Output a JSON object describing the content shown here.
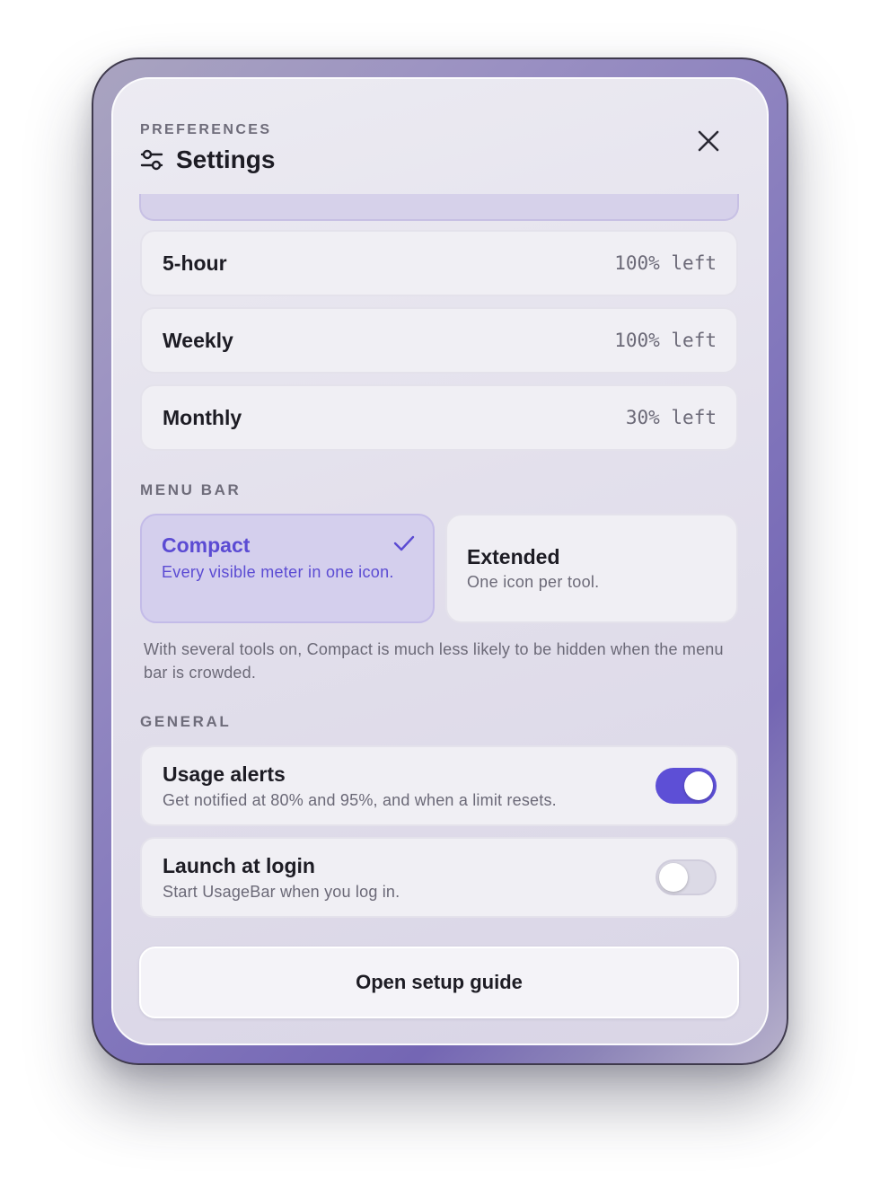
{
  "header": {
    "eyebrow": "PREFERENCES",
    "title": "Settings",
    "title_icon": "sliders-icon",
    "close_icon": "close-icon"
  },
  "meters": [
    {
      "label": "5-hour",
      "value": "100% left"
    },
    {
      "label": "Weekly",
      "value": "100% left"
    },
    {
      "label": "Monthly",
      "value": "30% left"
    }
  ],
  "menu_bar": {
    "section_label": "MENU BAR",
    "options": [
      {
        "title": "Compact",
        "description": "Every visible meter in one icon.",
        "selected": true
      },
      {
        "title": "Extended",
        "description": "One icon per tool.",
        "selected": false
      }
    ],
    "help_text": "With several tools on, Compact is much less likely to be hidden when the menu bar is crowded."
  },
  "general": {
    "section_label": "GENERAL",
    "settings": [
      {
        "title": "Usage alerts",
        "description": "Get notified at 80% and 95%, and when a limit resets.",
        "enabled": true
      },
      {
        "title": "Launch at login",
        "description": "Start UsageBar when you log in.",
        "enabled": false
      }
    ]
  },
  "footer": {
    "setup_button_label": "Open setup guide"
  },
  "colors": {
    "accent": "#5d4fd6",
    "accent_text": "#5b4bd3",
    "selected_card": "#d4cfed"
  }
}
